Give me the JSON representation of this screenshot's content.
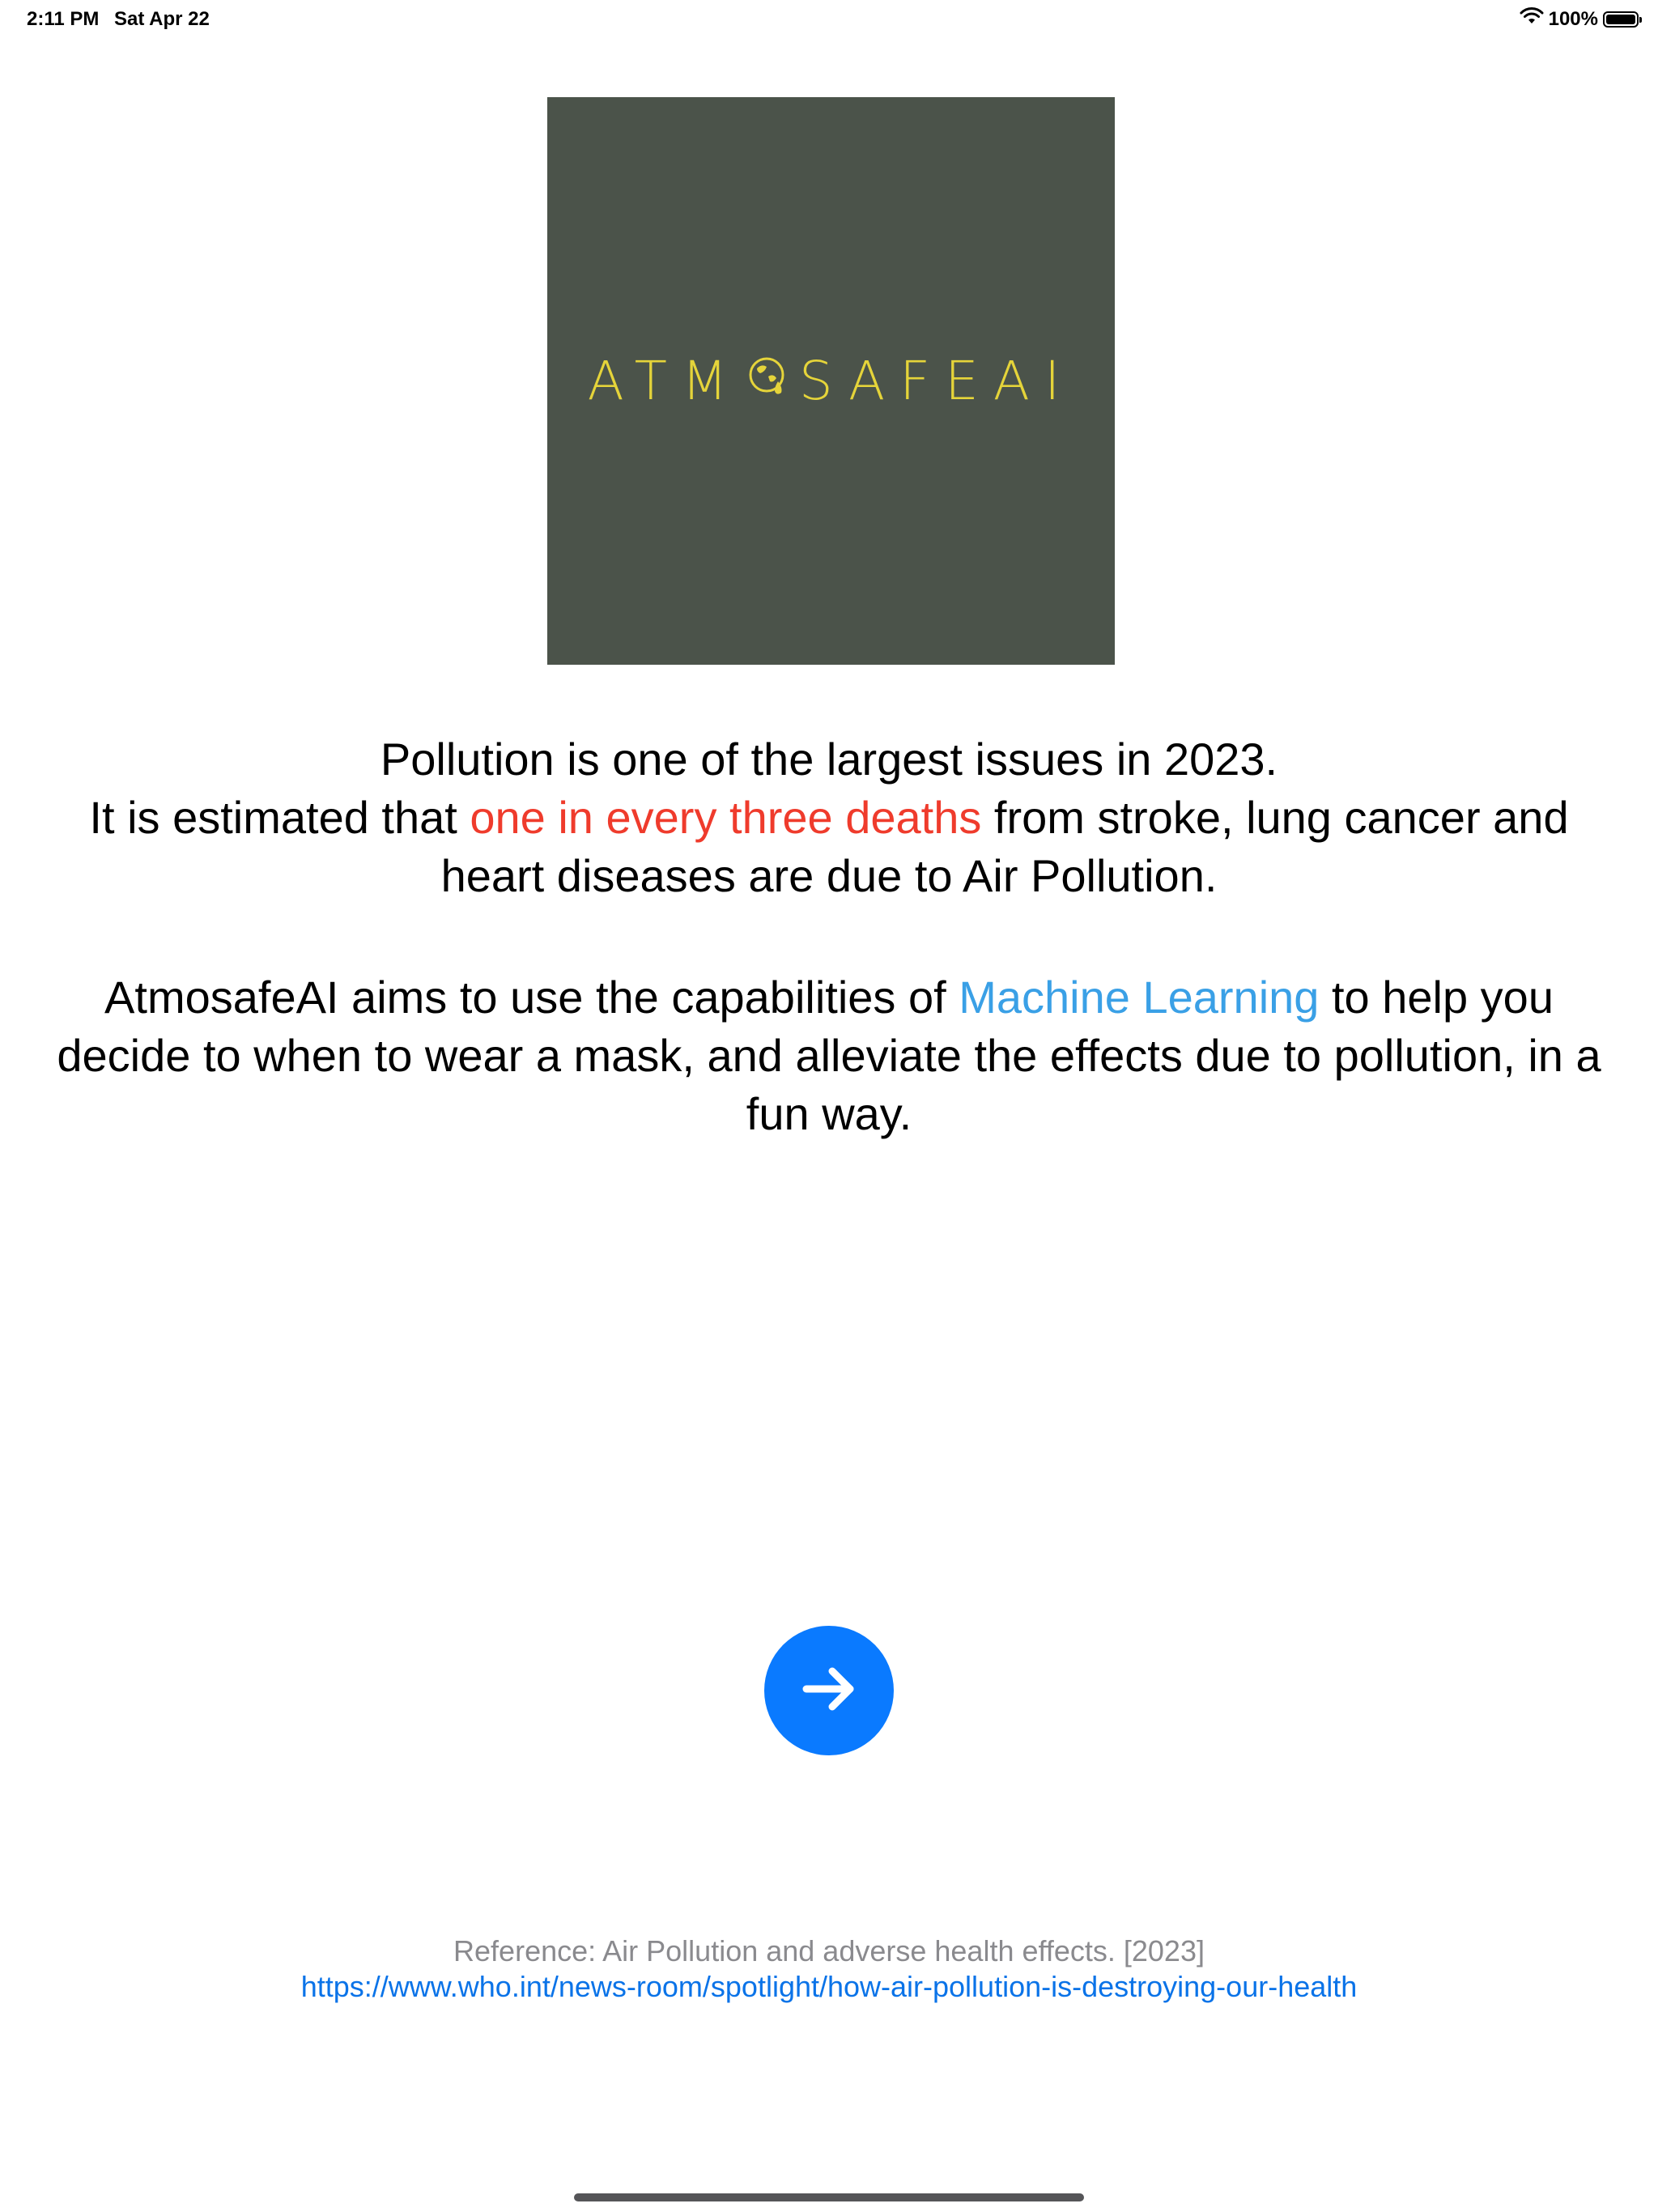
{
  "status_bar": {
    "time": "2:11 PM",
    "date": "Sat Apr 22",
    "battery": "100%",
    "battery_level": 1.0,
    "icons": [
      "wifi-icon",
      "battery-icon"
    ]
  },
  "logo": {
    "text_before": "ATM",
    "text_after": "SAFEAI",
    "background_color": "#4b534a",
    "text_color": "#e5d43a",
    "icon": "globe-icon"
  },
  "intro": {
    "line1": "Pollution is one of the largest issues in 2023.",
    "line2_before": "It is estimated that ",
    "line2_highlight": "one in every three deaths",
    "line2_after": " from stroke, lung cancer and heart diseases are due to Air Pollution.",
    "highlight_color": "#ef3b2c"
  },
  "mission": {
    "before": "AtmosafeAI aims to use the capabilities of ",
    "highlight": "Machine Learning",
    "after": " to help you decide to when to wear a mask, and alleviate the effects due to pollution, in a fun way.",
    "highlight_color": "#3aa0e6"
  },
  "next_button": {
    "icon": "arrow-right-icon",
    "color": "#0a7aff"
  },
  "reference": {
    "label": "Reference: Air Pollution and adverse health effects. [2023]",
    "url": "https://www.who.int/news-room/spotlight/how-air-pollution-is-destroying-our-health"
  }
}
